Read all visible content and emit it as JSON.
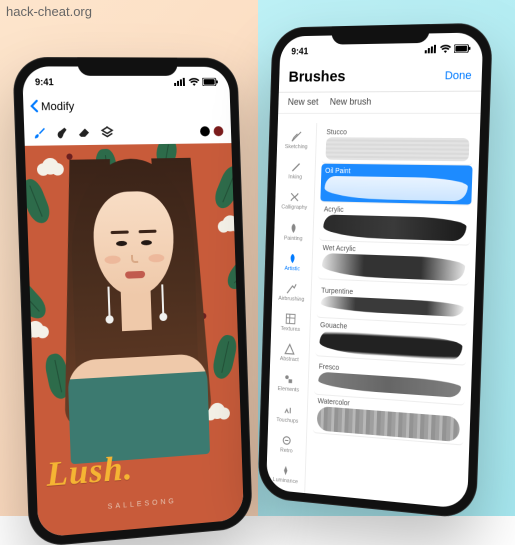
{
  "watermark": "hack-cheat.org",
  "status": {
    "time": "9:41"
  },
  "left_phone": {
    "back_label": "Modify",
    "swatches": [
      "#000000",
      "#7a1b1b"
    ],
    "artwork": {
      "title_text": "Lush.",
      "credit_text": "SALLESONG"
    }
  },
  "right_phone": {
    "header_title": "Brushes",
    "done_label": "Done",
    "actions": {
      "new_set": "New set",
      "new_brush": "New brush"
    },
    "categories": [
      {
        "label": "Sketching",
        "active": false
      },
      {
        "label": "Inking",
        "active": false
      },
      {
        "label": "Calligraphy",
        "active": false
      },
      {
        "label": "Painting",
        "active": false
      },
      {
        "label": "Artistic",
        "active": true
      },
      {
        "label": "Airbrushing",
        "active": false
      },
      {
        "label": "Textures",
        "active": false
      },
      {
        "label": "Abstract",
        "active": false
      },
      {
        "label": "Elements",
        "active": false
      },
      {
        "label": "Touchups",
        "active": false
      },
      {
        "label": "Retro",
        "active": false
      },
      {
        "label": "Luminance",
        "active": false
      }
    ],
    "brushes": [
      {
        "name": "Stucco",
        "style": "s-stucco",
        "selected": false
      },
      {
        "name": "Oil Paint",
        "style": "s-oil",
        "selected": true
      },
      {
        "name": "Acrylic",
        "style": "s-acrylic",
        "selected": false
      },
      {
        "name": "Wet Acrylic",
        "style": "s-wet",
        "selected": false
      },
      {
        "name": "Turpentine",
        "style": "s-turp",
        "selected": false
      },
      {
        "name": "Gouache",
        "style": "s-gouache",
        "selected": false
      },
      {
        "name": "Fresco",
        "style": "s-fresco",
        "selected": false
      },
      {
        "name": "Watercolor",
        "style": "s-water",
        "selected": false
      }
    ]
  }
}
